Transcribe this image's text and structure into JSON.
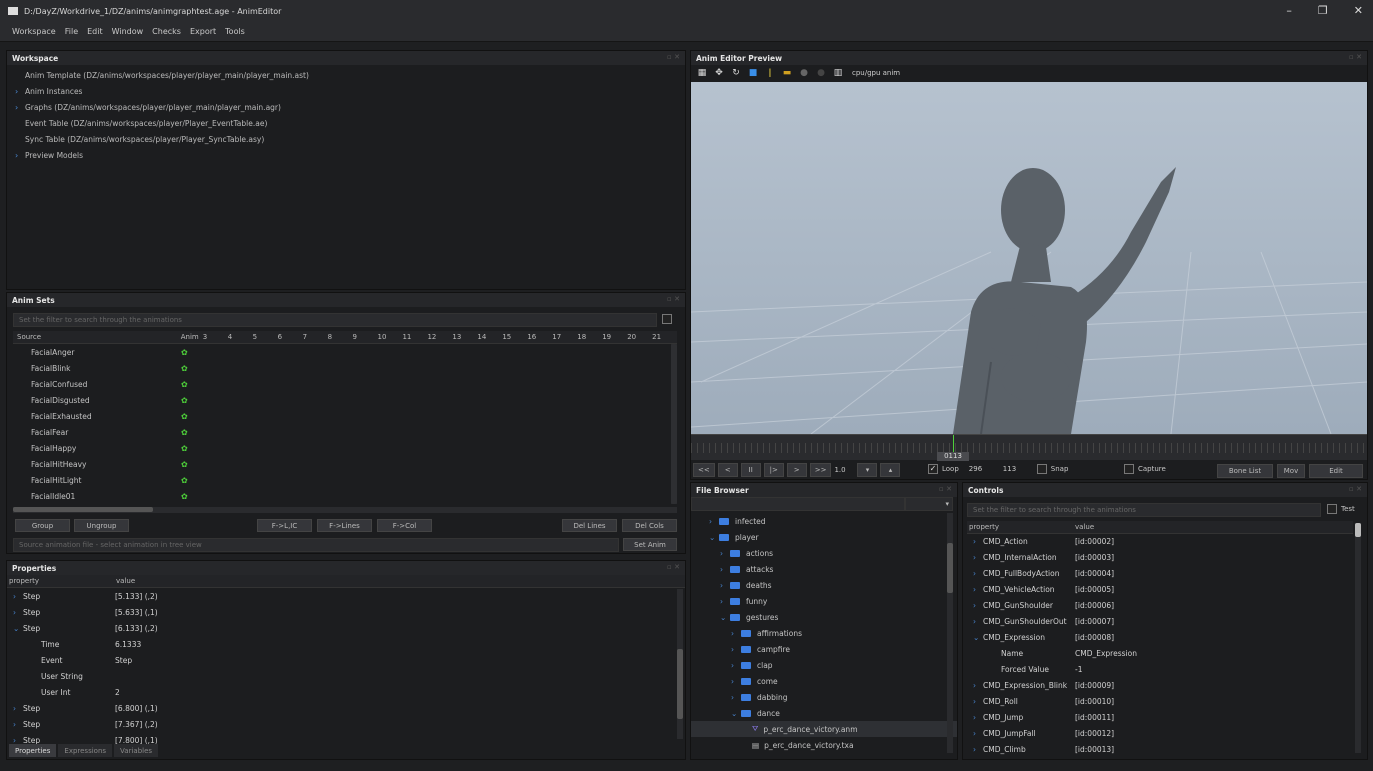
{
  "window": {
    "title": "D:/DayZ/Workdrive_1/DZ/anims/animgraphtest.age - AnimEditor",
    "minimize": "–",
    "maximize": "❐",
    "close": "✕"
  },
  "menu": [
    "Workspace",
    "File",
    "Edit",
    "Window",
    "Checks",
    "Export",
    "Tools"
  ],
  "workspace": {
    "title": "Workspace",
    "items": [
      {
        "label": "Anim Template (DZ/anims/workspaces/player/player_main/player_main.ast)",
        "expandable": false
      },
      {
        "label": "Anim Instances",
        "expandable": true
      },
      {
        "label": "Graphs (DZ/anims/workspaces/player/player_main/player_main.agr)",
        "expandable": true
      },
      {
        "label": "Event Table (DZ/anims/workspaces/player/Player_EventTable.ae)",
        "expandable": false
      },
      {
        "label": "Sync Table (DZ/anims/workspaces/player/Player_SyncTable.asy)",
        "expandable": false
      },
      {
        "label": "Preview Models",
        "expandable": true
      }
    ]
  },
  "animsets": {
    "title": "Anim Sets",
    "filter_placeholder": "Set the filter to search through the animations",
    "columns": [
      "Source",
      "Anim",
      "3",
      "4",
      "5",
      "6",
      "7",
      "8",
      "9",
      "10",
      "11",
      "12",
      "13",
      "14",
      "15",
      "16",
      "17",
      "18",
      "19",
      "20",
      "21"
    ],
    "rows": [
      "FacialAnger",
      "FacialBlink",
      "FacialConfused",
      "FacialDisgusted",
      "FacialExhausted",
      "FacialFear",
      "FacialHappy",
      "FacialHitHeavy",
      "FacialHitLight",
      "FacialIdle01"
    ],
    "buttons_left": [
      "Group",
      "Ungroup"
    ],
    "buttons_mid": [
      "F->L,IC",
      "F->Lines",
      "F->Col"
    ],
    "buttons_right": [
      "Del Lines",
      "Del Cols"
    ],
    "source_file_placeholder": "Source animation file - select animation in tree view",
    "set_anim": "Set Anim"
  },
  "properties": {
    "title": "Properties",
    "columns": [
      "property",
      "value"
    ],
    "rows": [
      {
        "k": "Step",
        "v": "[5.133] (,2)",
        "indent": 1,
        "arrow": "›"
      },
      {
        "k": "Step",
        "v": "[5.633] (,1)",
        "indent": 1,
        "arrow": "›"
      },
      {
        "k": "Step",
        "v": "[6.133] (,2)",
        "indent": 1,
        "arrow": "⌄"
      },
      {
        "k": "Time",
        "v": "6.1333",
        "indent": 2,
        "arrow": ""
      },
      {
        "k": "Event",
        "v": "Step",
        "indent": 2,
        "arrow": ""
      },
      {
        "k": "User String",
        "v": "",
        "indent": 2,
        "arrow": ""
      },
      {
        "k": "User Int",
        "v": "2",
        "indent": 2,
        "arrow": ""
      },
      {
        "k": "Step",
        "v": "[6.800] (,1)",
        "indent": 1,
        "arrow": "›"
      },
      {
        "k": "Step",
        "v": "[7.367] (,2)",
        "indent": 1,
        "arrow": "›"
      },
      {
        "k": "Step",
        "v": "[7.800] (,1)",
        "indent": 1,
        "arrow": "›"
      }
    ],
    "tabs": [
      "Properties",
      "Expressions",
      "Variables"
    ]
  },
  "preview": {
    "title": "Anim Editor Preview",
    "mode_label": "cpu/gpu anim",
    "timeline_value": "0113",
    "controls": {
      "rew": "<<",
      "prev": "<",
      "pause": "II",
      "play": "|>",
      "next": ">",
      "ff": ">>",
      "speed": "1.0"
    },
    "loop_label": "Loop",
    "loop_checked": true,
    "frame_total": "296",
    "frame_current": "113",
    "snap_label": "Snap",
    "capture_label": "Capture",
    "bone_list": "Bone List",
    "mov": "Mov",
    "edit": "Edit"
  },
  "filebrowser": {
    "title": "File Browser",
    "items": [
      {
        "label": "infected",
        "level": 2,
        "open": false,
        "type": "folder"
      },
      {
        "label": "player",
        "level": 2,
        "open": true,
        "type": "folder"
      },
      {
        "label": "actions",
        "level": 3,
        "open": false,
        "type": "folder"
      },
      {
        "label": "attacks",
        "level": 3,
        "open": false,
        "type": "folder"
      },
      {
        "label": "deaths",
        "level": 3,
        "open": false,
        "type": "folder"
      },
      {
        "label": "funny",
        "level": 3,
        "open": false,
        "type": "folder"
      },
      {
        "label": "gestures",
        "level": 3,
        "open": true,
        "type": "folder"
      },
      {
        "label": "affirmations",
        "level": 4,
        "open": false,
        "type": "folder"
      },
      {
        "label": "campfire",
        "level": 4,
        "open": false,
        "type": "folder"
      },
      {
        "label": "clap",
        "level": 4,
        "open": false,
        "type": "folder"
      },
      {
        "label": "come",
        "level": 4,
        "open": false,
        "type": "folder"
      },
      {
        "label": "dabbing",
        "level": 4,
        "open": false,
        "type": "folder"
      },
      {
        "label": "dance",
        "level": 4,
        "open": true,
        "type": "folder"
      },
      {
        "label": "p_erc_dance_victory.anm",
        "level": 5,
        "open": false,
        "type": "anim"
      },
      {
        "label": "p_erc_dance_victory.txa",
        "level": 5,
        "open": false,
        "type": "file"
      }
    ]
  },
  "controls": {
    "title": "Controls",
    "filter_placeholder": "Set the filter to search through the animations",
    "test_label": "Test",
    "columns": [
      "property",
      "value"
    ],
    "rows": [
      {
        "k": "CMD_Action",
        "v": "[id:00002]",
        "indent": 1,
        "arrow": "›"
      },
      {
        "k": "CMD_InternalAction",
        "v": "[id:00003]",
        "indent": 1,
        "arrow": "›"
      },
      {
        "k": "CMD_FullBodyAction",
        "v": "[id:00004]",
        "indent": 1,
        "arrow": "›"
      },
      {
        "k": "CMD_VehicleAction",
        "v": "[id:00005]",
        "indent": 1,
        "arrow": "›"
      },
      {
        "k": "CMD_GunShoulder",
        "v": "[id:00006]",
        "indent": 1,
        "arrow": "›"
      },
      {
        "k": "CMD_GunShoulderOut",
        "v": "[id:00007]",
        "indent": 1,
        "arrow": "›"
      },
      {
        "k": "CMD_Expression",
        "v": "[id:00008]",
        "indent": 1,
        "arrow": "⌄"
      },
      {
        "k": "Name",
        "v": "CMD_Expression",
        "indent": 2,
        "arrow": ""
      },
      {
        "k": "Forced Value",
        "v": "-1",
        "indent": 2,
        "arrow": ""
      },
      {
        "k": "CMD_Expression_Blink",
        "v": "[id:00009]",
        "indent": 1,
        "arrow": "›"
      },
      {
        "k": "CMD_Roll",
        "v": "[id:00010]",
        "indent": 1,
        "arrow": "›"
      },
      {
        "k": "CMD_Jump",
        "v": "[id:00011]",
        "indent": 1,
        "arrow": "›"
      },
      {
        "k": "CMD_JumpFall",
        "v": "[id:00012]",
        "indent": 1,
        "arrow": "›"
      },
      {
        "k": "CMD_Climb",
        "v": "[id:00013]",
        "indent": 1,
        "arrow": "›"
      }
    ]
  }
}
